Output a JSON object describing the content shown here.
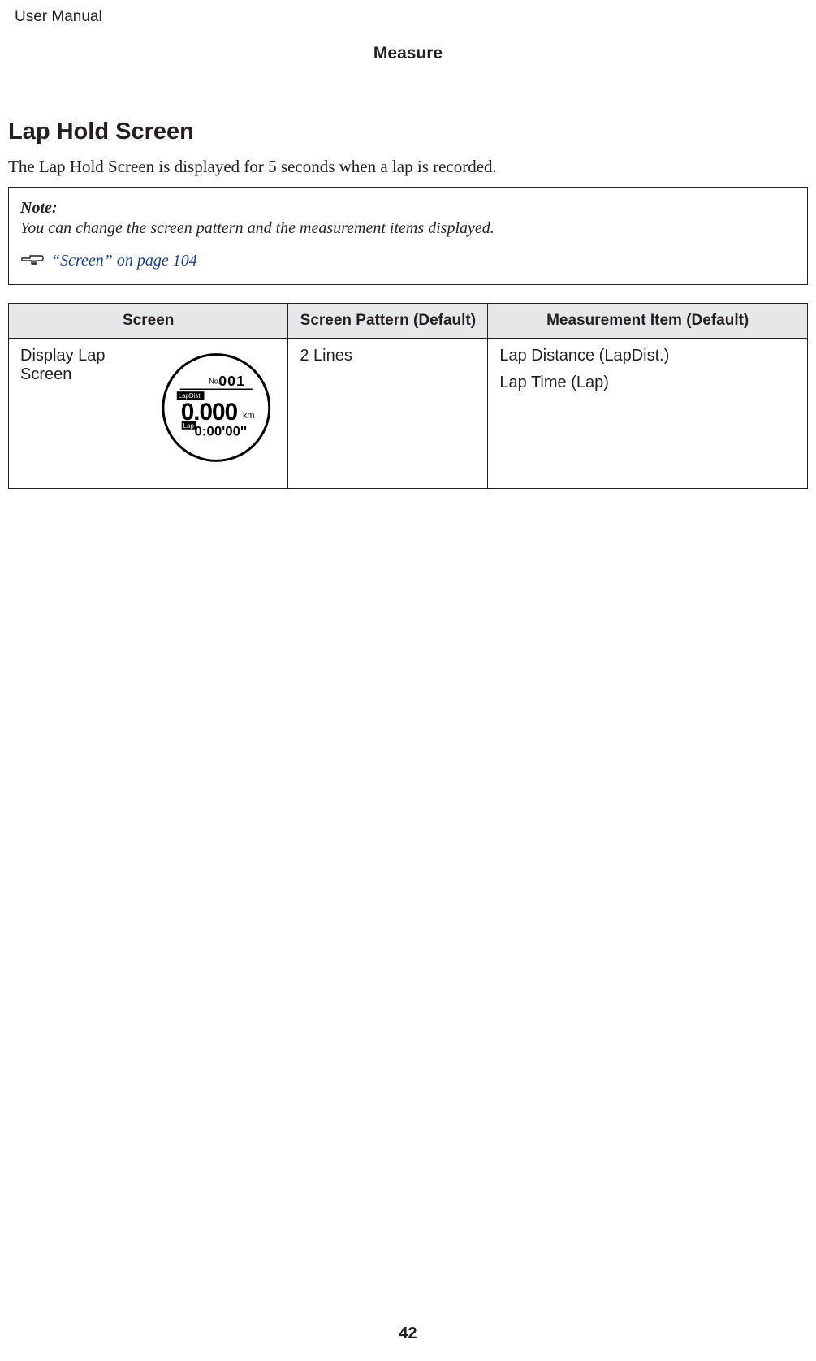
{
  "header": {
    "running_head": "User Manual",
    "chapter": "Measure"
  },
  "section": {
    "title": "Lap Hold Screen",
    "intro": "The Lap Hold Screen is displayed for 5 seconds when a lap is recorded."
  },
  "note": {
    "label": "Note:",
    "body": "You can change the screen pattern and the measurement items displayed.",
    "xref": "“Screen” on page 104"
  },
  "table": {
    "headers": {
      "screen": "Screen",
      "pattern": "Screen Pattern (Default)",
      "measurement": "Measurement Item (Default)"
    },
    "rows": [
      {
        "screen_label": "Display Lap Screen",
        "pattern": "2 Lines",
        "measurements": [
          "Lap Distance (LapDist.)",
          "Lap Time (Lap)"
        ],
        "watch": {
          "lap_no_label": "No.",
          "lap_no": "001",
          "line1_label": "LapDist.",
          "line1_value": "0.000",
          "line1_unit": "km",
          "line2_label": "Lap",
          "line2_value": "0:00'00''"
        }
      }
    ]
  },
  "page_number": "42"
}
